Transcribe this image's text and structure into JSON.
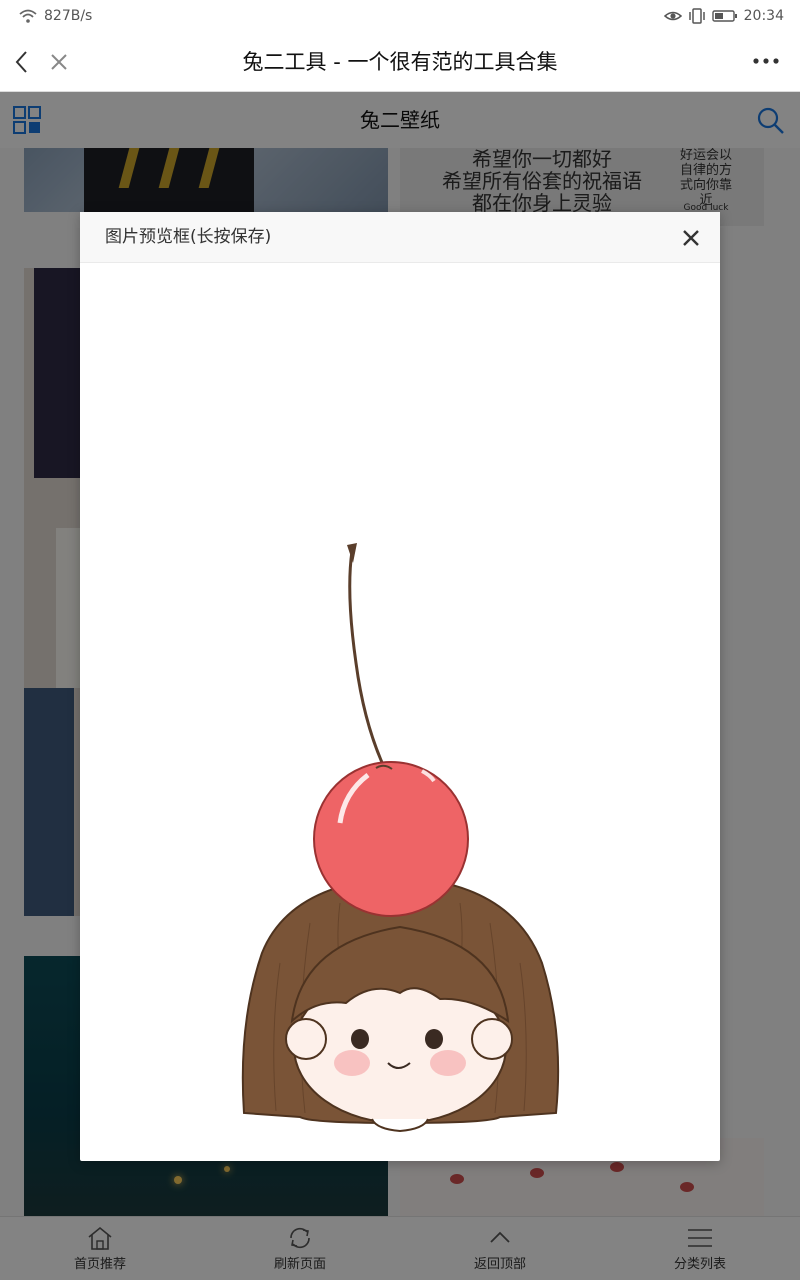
{
  "status_bar": {
    "net_speed": "827B/s",
    "time": "20:34",
    "icons": [
      "wifi-icon",
      "eye-icon",
      "vibrate-icon",
      "battery-icon"
    ]
  },
  "browser": {
    "title": "兔二工具 - 一个很有范的工具合集",
    "icons": [
      "back-icon",
      "close-icon",
      "more-icon"
    ]
  },
  "app_header": {
    "title": "兔二壁纸",
    "icons": [
      "grid-icon",
      "search-icon"
    ],
    "accent_color": "#1a73d9"
  },
  "background_cards": {
    "text_card": {
      "lines": [
        "希望你一切都好",
        "希望所有俗套的祝福语",
        "都在你身上灵验"
      ],
      "side_lines": [
        "好运会以",
        "自律的方",
        "式向你靠",
        "近"
      ],
      "side_footer": "Good luck"
    }
  },
  "modal": {
    "title": "图片预览框(长按保存)",
    "close_icon": "close-icon",
    "image": "cherry-girl-illustration"
  },
  "bottom_nav": {
    "items": [
      {
        "label": "首页推荐",
        "icon": "home-icon"
      },
      {
        "label": "刷新页面",
        "icon": "refresh-icon"
      },
      {
        "label": "返回顶部",
        "icon": "chevron-up-icon"
      },
      {
        "label": "分类列表",
        "icon": "menu-icon"
      }
    ]
  }
}
